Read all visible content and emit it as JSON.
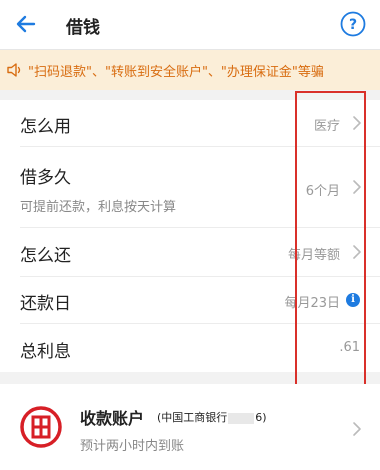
{
  "header": {
    "title": "借钱"
  },
  "notice": {
    "text": "\"扫码退款\"、\"转账到安全账户\"、\"办理保证金\"等骗"
  },
  "rows": [
    {
      "label": "怎么用",
      "value": "医疗"
    },
    {
      "label": "借多久",
      "sublabel": "可提前还款，利息按天计算",
      "value": "6个月"
    },
    {
      "label": "怎么还",
      "value": "每月等额"
    },
    {
      "label": "还款日",
      "value": "每月23日"
    },
    {
      "label": "总利息",
      "value": ".61"
    }
  ],
  "account": {
    "title": "收款账户",
    "bank": "(中国工商银行",
    "bank_suffix": "6)",
    "subtitle": "预计两小时内到账"
  },
  "colors": {
    "notice_bg": "#fbeed8",
    "notice_text": "#d86c10",
    "highlight_border": "#d9302a",
    "accent_blue": "#1e7be0",
    "icbc_red": "#d71f26"
  }
}
